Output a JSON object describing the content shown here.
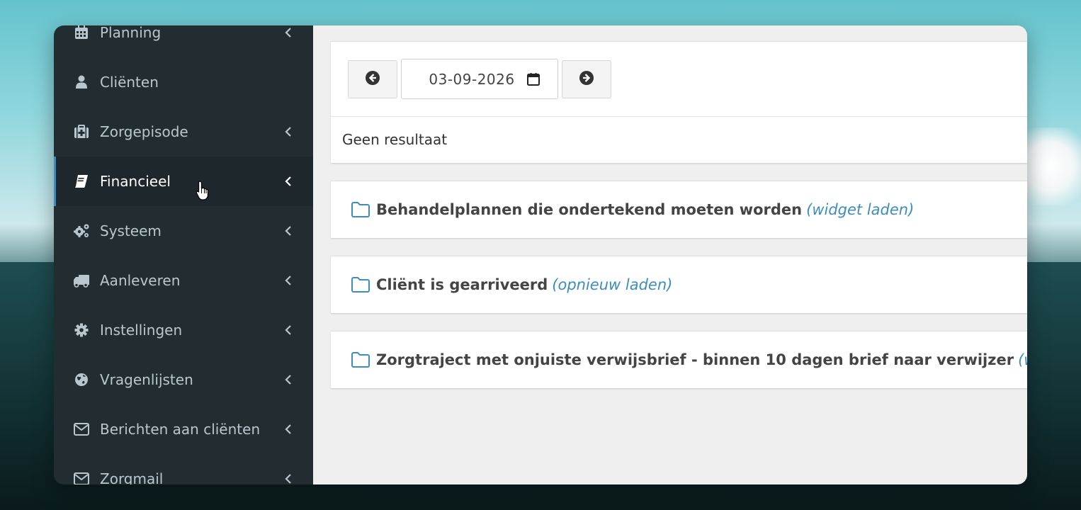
{
  "sidebar": {
    "items": [
      {
        "label": "Planning",
        "icon": "calendar-icon",
        "expandable": true,
        "active": false
      },
      {
        "label": "Cliënten",
        "icon": "user-icon",
        "expandable": false,
        "active": false
      },
      {
        "label": "Zorgepisode",
        "icon": "medkit-icon",
        "expandable": true,
        "active": false
      },
      {
        "label": "Financieel",
        "icon": "book-icon",
        "expandable": true,
        "active": true
      },
      {
        "label": "Systeem",
        "icon": "gears-icon",
        "expandable": true,
        "active": false
      },
      {
        "label": "Aanleveren",
        "icon": "truck-icon",
        "expandable": true,
        "active": false
      },
      {
        "label": "Instellingen",
        "icon": "gear-icon",
        "expandable": true,
        "active": false
      },
      {
        "label": "Vragenlijsten",
        "icon": "globe-icon",
        "expandable": true,
        "active": false
      },
      {
        "label": "Berichten aan cliënten",
        "icon": "envelope-icon",
        "expandable": true,
        "active": false
      },
      {
        "label": "Zorgmail",
        "icon": "envelope-icon",
        "expandable": true,
        "active": false
      }
    ]
  },
  "date_nav": {
    "date_value": "03-09-2026"
  },
  "results": {
    "empty_text": "Geen resultaat"
  },
  "widgets": [
    {
      "title": "Behandelplannen die ondertekend moeten worden",
      "link": "(widget laden)"
    },
    {
      "title": "Cliënt is gearriveerd",
      "link": "(opnieuw laden)"
    },
    {
      "title": "Zorgtraject met onjuiste verwijsbrief - binnen 10 dagen brief naar verwijzer",
      "link": "(widget laden)"
    }
  ],
  "colors": {
    "sidebar_bg": "#222d32",
    "sidebar_active_bg": "#1e282c",
    "accent": "#3c8dbc",
    "sidebar_text": "#b8c7ce"
  }
}
